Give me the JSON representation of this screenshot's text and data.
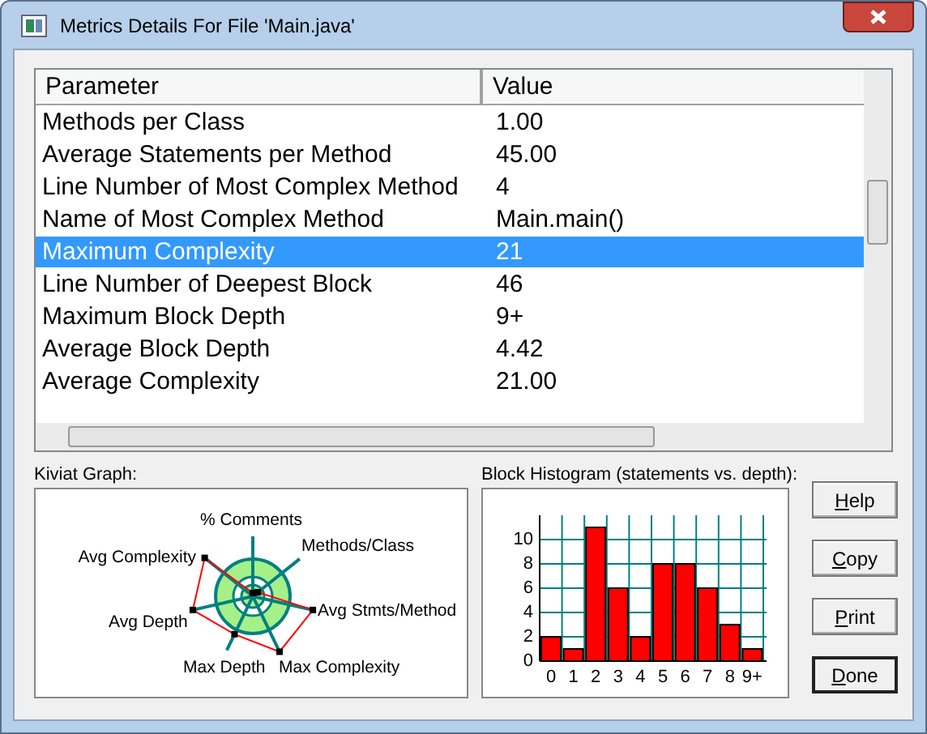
{
  "window": {
    "title": "Metrics Details For File 'Main.java'"
  },
  "table": {
    "columns": [
      "Parameter",
      "Value"
    ],
    "rows": [
      {
        "parameter": "Methods per Class",
        "value": "1.00",
        "selected": false
      },
      {
        "parameter": "Average Statements per Method",
        "value": "45.00",
        "selected": false
      },
      {
        "parameter": "Line Number of Most Complex Method",
        "value": "4",
        "selected": false
      },
      {
        "parameter": "Name of Most Complex Method",
        "value": "Main.main()",
        "selected": false
      },
      {
        "parameter": "Maximum Complexity",
        "value": "21",
        "selected": true
      },
      {
        "parameter": "Line Number of Deepest Block",
        "value": "46",
        "selected": false
      },
      {
        "parameter": "Maximum Block Depth",
        "value": "9+",
        "selected": false
      },
      {
        "parameter": "Average Block Depth",
        "value": "4.42",
        "selected": false
      },
      {
        "parameter": "Average Complexity",
        "value": "21.00",
        "selected": false
      }
    ]
  },
  "kiviat": {
    "label": "Kiviat Graph:",
    "axes": [
      "% Comments",
      "Avg Complexity",
      "Methods/Class",
      "Avg Depth",
      "Avg Stmts/Method",
      "Max Depth",
      "Max Complexity"
    ]
  },
  "histogram": {
    "label": "Block Histogram (statements vs. depth):",
    "chart_data": {
      "type": "bar",
      "categories": [
        "0",
        "1",
        "2",
        "3",
        "4",
        "5",
        "6",
        "7",
        "8",
        "9+"
      ],
      "series": [
        {
          "color": "#ff0000",
          "values": [
            2,
            1,
            11,
            6,
            2,
            8,
            8,
            6,
            3,
            1
          ]
        }
      ],
      "ylim": [
        0,
        12
      ],
      "yticks": [
        0,
        2,
        4,
        6,
        8,
        10
      ],
      "grid": true
    }
  },
  "buttons": [
    {
      "label": "Help",
      "default": false
    },
    {
      "label": "Copy",
      "default": false
    },
    {
      "label": "Print",
      "default": false
    },
    {
      "label": "Done",
      "default": true
    }
  ]
}
